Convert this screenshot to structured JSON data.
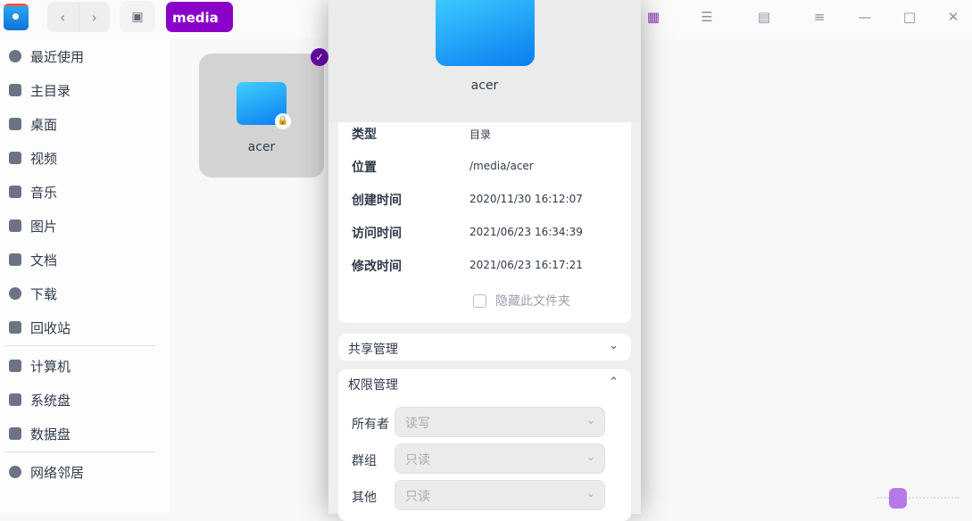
{
  "breadcrumb": "media",
  "sidebar": {
    "items": [
      {
        "label": "最近使用",
        "icon": "clock-icon"
      },
      {
        "label": "主目录",
        "icon": "home-icon"
      },
      {
        "label": "桌面",
        "icon": "desktop-icon"
      },
      {
        "label": "视频",
        "icon": "video-icon"
      },
      {
        "label": "音乐",
        "icon": "music-icon"
      },
      {
        "label": "图片",
        "icon": "picture-icon"
      },
      {
        "label": "文档",
        "icon": "document-icon"
      },
      {
        "label": "下载",
        "icon": "download-icon"
      },
      {
        "label": "回收站",
        "icon": "trash-icon"
      },
      {
        "label": "计算机",
        "icon": "computer-icon"
      },
      {
        "label": "系统盘",
        "icon": "disk-icon"
      },
      {
        "label": "数据盘",
        "icon": "disk-icon"
      },
      {
        "label": "网络邻居",
        "icon": "network-icon"
      }
    ]
  },
  "file": {
    "name": "acer"
  },
  "dialog": {
    "name": "acer",
    "info": [
      {
        "label": "类型",
        "value": "目录"
      },
      {
        "label": "位置",
        "value": "/media/acer"
      },
      {
        "label": "创建时间",
        "value": "2020/11/30 16:12:07"
      },
      {
        "label": "访问时间",
        "value": "2021/06/23 16:34:39"
      },
      {
        "label": "修改时间",
        "value": "2021/06/23 16:17:21"
      }
    ],
    "hide_label": "隐藏此文件夹",
    "share_title": "共享管理",
    "perm_title": "权限管理",
    "perms": [
      {
        "label": "所有者",
        "value": "读写"
      },
      {
        "label": "群组",
        "value": "只读"
      },
      {
        "label": "其他",
        "value": "只读"
      }
    ]
  },
  "colors": {
    "accent": "#8a00c8"
  }
}
